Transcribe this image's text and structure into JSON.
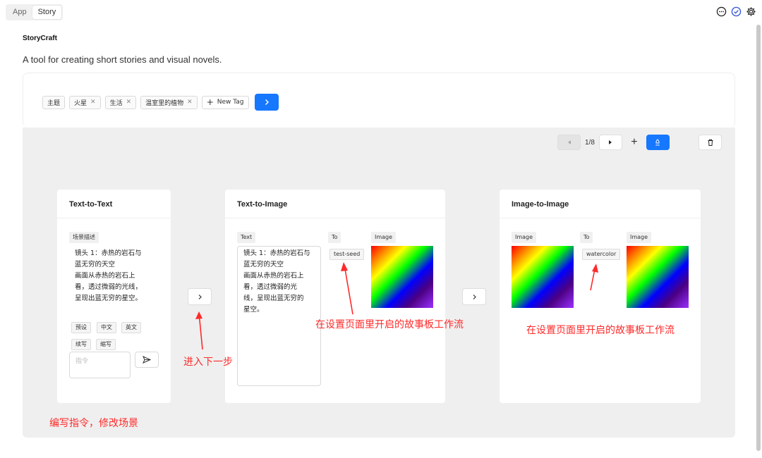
{
  "top_tabs": [
    "App",
    "Story"
  ],
  "header": {
    "title": "StoryCraft",
    "description": "A tool for creating short stories and visual novels."
  },
  "tags": [
    "主题",
    "火星",
    "生活",
    "温室里的植物"
  ],
  "new_tag_label": "New Tag",
  "pager": {
    "page": "1/8"
  },
  "cards": {
    "t2t": {
      "title": "Text-to-Text",
      "scene_label": "场景描述",
      "scene_text": [
        "镜头 1：赤热的岩石与",
        "蓝无穷的天空",
        "画面从赤热的岩石上",
        "看，透过微弱的光线，",
        "呈现出蓝无穷的星空。"
      ],
      "chips": [
        "预设",
        "中文",
        "英文",
        "续写",
        "缩写"
      ],
      "instruction_placeholder": "指令"
    },
    "t2i": {
      "title": "Text-to-Image",
      "text_label": "Text",
      "to_label": "To",
      "image_label": "Image",
      "text_value": [
        "镜头 1：赤热的岩石与",
        "蓝无穷的天空",
        "画面从赤热的岩石上",
        "看，透过微弱的光",
        "线，呈现出蓝无穷的",
        "星空。"
      ],
      "seed": "test-seed"
    },
    "i2i": {
      "title": "Image-to-Image",
      "image_label_in": "Image",
      "to_label": "To",
      "image_label_out": "Image",
      "style": "watercolor"
    }
  },
  "annotations": {
    "edit": "编写指令，修改场景",
    "next": "进入下一步",
    "storyboard_1": "在设置页面里开启的故事板工作流",
    "storyboard_2": "在设置页面里开启的故事板工作流"
  },
  "colors": {
    "accent": "#1677ff",
    "annotation": "#ff2a2a",
    "stage": "#efefef"
  }
}
